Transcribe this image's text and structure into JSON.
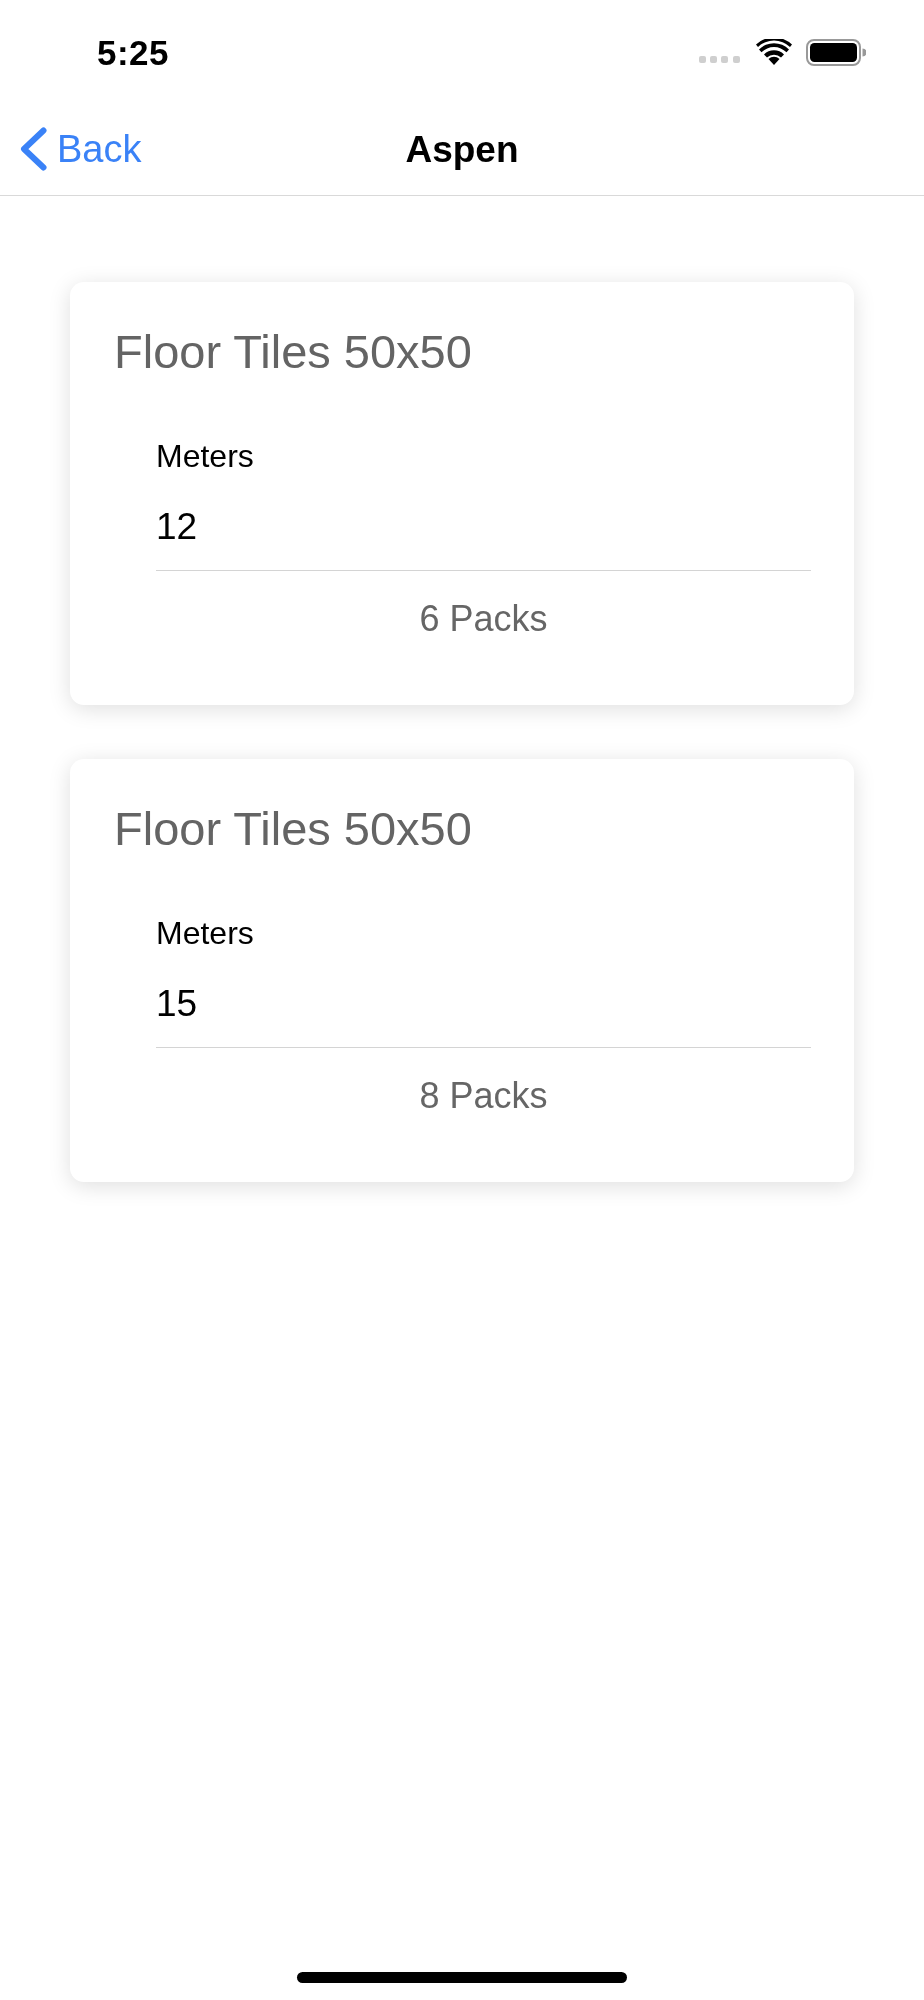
{
  "status_bar": {
    "time": "5:25"
  },
  "nav_bar": {
    "back_label": "Back",
    "title": "Aspen"
  },
  "items": [
    {
      "title": "Floor Tiles 50x50",
      "field_label": "Meters",
      "value": "12",
      "result": "6 Packs"
    },
    {
      "title": "Floor Tiles 50x50",
      "field_label": "Meters",
      "value": "15",
      "result": "8 Packs"
    }
  ]
}
